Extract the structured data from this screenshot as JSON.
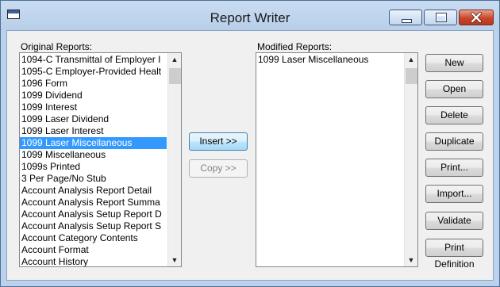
{
  "window": {
    "title": "Report Writer"
  },
  "original_reports": {
    "label": "Original Reports:",
    "items": [
      "1094-C Transmittal of Employer I",
      "1095-C Employer-Provided Healt",
      "1096 Form",
      "1099 Dividend",
      "1099 Interest",
      "1099 Laser Dividend",
      "1099 Laser Interest",
      "1099 Laser Miscellaneous",
      "1099 Miscellaneous",
      "1099s Printed",
      "3 Per Page/No Stub",
      "Account Analysis Report Detail",
      "Account Analysis Report Summa",
      "Account Analysis Setup Report D",
      "Account Analysis Setup Report S",
      "Account Category Contents",
      "Account Format",
      "Account History"
    ],
    "selected_index": 7
  },
  "modified_reports": {
    "label": "Modified Reports:",
    "items": [
      "1099 Laser Miscellaneous"
    ]
  },
  "center_buttons": {
    "insert": "Insert >>",
    "copy": "Copy >>"
  },
  "side_buttons": [
    "New",
    "Open",
    "Delete",
    "Duplicate",
    "Print...",
    "Import...",
    "Validate",
    "Print Definition"
  ],
  "icons": {
    "system": "window-icon",
    "minimize": "minimize-icon",
    "maximize": "maximize-icon",
    "close": "close-icon",
    "scroll_up": "chevron-up-icon",
    "scroll_down": "chevron-down-icon"
  },
  "colors": {
    "selection": "#3399ff",
    "title_bar": "#bcd2ec",
    "close_button": "#c9452a"
  }
}
